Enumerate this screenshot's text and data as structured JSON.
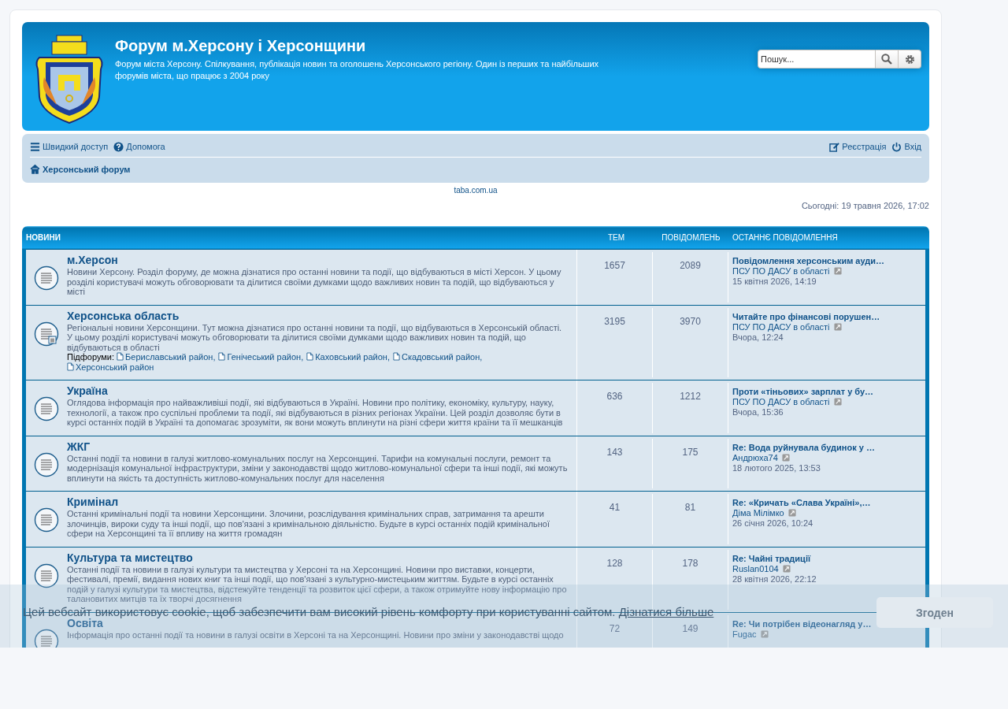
{
  "header": {
    "title": "Форум м.Херсону і Херсонщини",
    "description": "Форум міста Херсону. Спілкування, публікація новин та оголошень Херсонського регіону. Один із перших та найбільших форумів міста, що працює з 2004 року",
    "search": {
      "placeholder": "Пошук..."
    }
  },
  "nav": {
    "left": [
      {
        "label": "Швидкий доступ"
      },
      {
        "label": "Допомога"
      }
    ],
    "right": [
      {
        "label": "Реєстрація"
      },
      {
        "label": "Вхід"
      }
    ],
    "breadcrumb": {
      "label": "Херсонський форум"
    }
  },
  "ad_link": "taba.com.ua",
  "current_time": "Сьогодні: 19 травня 2026, 17:02",
  "category": {
    "title": "НОВИНИ",
    "columns": [
      "ТЕМ",
      "ПОВІДОМЛЕНЬ",
      "ОСТАННЄ ПОВІДОМЛЕННЯ"
    ],
    "forums": [
      {
        "name": "м.Херсон",
        "description": "Новини Херсону. Розділ форуму, де можна дізнатися про останні новини та події, що відбуваються в місті Херсон. У цьому розділі користувачі можуть обговорювати та ділитися своїми думками щодо важливих новин та подій, що відбуваються у місті",
        "topics": "1657",
        "posts": "2089",
        "last_post": {
          "title": "Повідомлення херсонським ауди…",
          "author": "ПСУ ПО ДАСУ в області",
          "time": "15 квітня 2026, 14:19"
        }
      },
      {
        "name": "Херсонська область",
        "description": "Регіональні новини Херсонщини. Тут можна дізнатися про останні новини та події, що відбуваються в Херсонській області. У цьому розділі користувачі можуть обговорювати та ділитися своїми думками щодо важливих новин та подій, що відбуваються в області",
        "subforums_label": "Підфоруми:",
        "subforum_separator": ",",
        "subforums": [
          "Бериславський район",
          "Генічеський район",
          "Каховський район",
          "Скадовський район",
          "Херсонський район"
        ],
        "topics": "3195",
        "posts": "3970",
        "last_post": {
          "title": "Читайте про фінансові порушен…",
          "author": "ПСУ ПО ДАСУ в області",
          "time": "Вчора, 12:24"
        }
      },
      {
        "name": "Україна",
        "description": "Оглядова інформація про найважливіші події, які відбуваються в Україні. Новини про політику, економіку, культуру, науку, технології, а також про суспільні проблеми та події, які відбуваються в різних регіонах України. Цей розділ дозволяє бути в курсі останніх подій в Україні та допомагає зрозуміти, як вони можуть вплинути на різні сфери життя країни та її мешканців",
        "topics": "636",
        "posts": "1212",
        "last_post": {
          "title": "Проти «тіньових» зарплат у бу…",
          "author": "ПСУ ПО ДАСУ в області",
          "time": "Вчора, 15:36"
        }
      },
      {
        "name": "ЖКГ",
        "description": "Останні події та новини в галузі житлово-комунальних послуг на Херсонщині. Тарифи на комунальні послуги, ремонт та модернізація комунальної інфраструктури, зміни у законодавстві щодо житлово-комунальної сфери та інші події, які можуть вплинути на якість та доступність житлово-комунальних послуг для населення",
        "topics": "143",
        "posts": "175",
        "last_post": {
          "title": "Re: Вода руйнувала будинок у …",
          "author": "Андрюха74",
          "time": "18 лютого 2025, 13:53"
        }
      },
      {
        "name": "Кримінал",
        "description": "Останні кримінальні події та новини Херсонщини. Злочини, розслідування кримінальних справ, затримання та арешти злочинців, вироки суду та інші події, що пов'язані з кримінальною діяльністю. Будьте в курсі останніх подій кримінальної сфери на Херсонщині та її впливу на життя громадян",
        "topics": "41",
        "posts": "81",
        "last_post": {
          "title": "Re: «Кричать «Слава Україні»,…",
          "author": "Діма Мілімко",
          "time": "26 січня 2026, 10:24"
        }
      },
      {
        "name": "Культура та мистецтво",
        "description": "Останні події та новини в галузі культури та мистецтва у Херсоні та на Херсонщині. Новини про виставки, концерти, фестивалі, премії, видання нових книг та інші події, що пов'язані з культурно-мистецьким життям. Будьте в курсі останніх подій у галузі культури та мистецтва, відстежуйте тенденції та розвиток цієї сфери, а також отримуйте нову інформацію про талановитих митців та їх творчі досягнення",
        "topics": "128",
        "posts": "178",
        "last_post": {
          "title": "Re: Чайні традиції",
          "author": "Ruslan0104",
          "time": "28 квітня 2026, 22:12"
        }
      },
      {
        "name": "Освіта",
        "description": "Інформація про останні події та новини в галузі освіти в Херсоні та на Херсонщині. Новини про зміни у законодавстві щодо",
        "topics": "72",
        "posts": "149",
        "last_post": {
          "title": "Re: Чи потрібен відеонагляд у…",
          "author": "Fugac"
        }
      }
    ]
  },
  "cookie_banner": {
    "text": "Цей вебсайт використовує cookie, щоб забезпечити вам високий рівень комфорту при користуванні сайтом.",
    "link": "Дізнатися більше",
    "button": "Згоден"
  }
}
